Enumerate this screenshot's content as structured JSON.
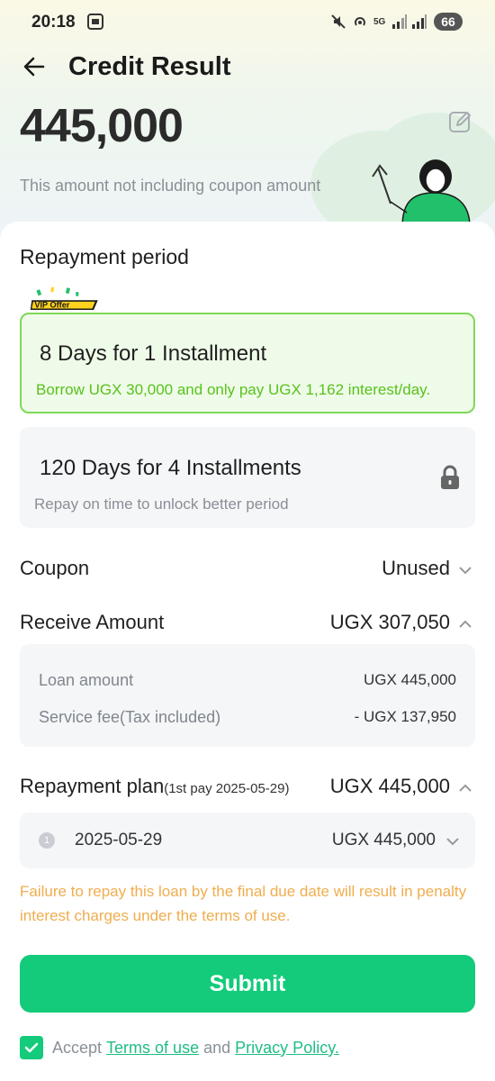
{
  "status_bar": {
    "time": "20:18",
    "battery": "66"
  },
  "header": {
    "title": "Credit Result"
  },
  "hero": {
    "amount": "445,000",
    "note": "This amount not including coupon amount"
  },
  "repayment_period": {
    "title": "Repayment period",
    "badge": "VIP Offer",
    "options": [
      {
        "title": "8 Days for 1 Installment",
        "subtitle": "Borrow UGX 30,000 and only pay UGX 1,162 interest/day."
      },
      {
        "title": "120 Days for 4 Installments",
        "subtitle": "Repay on time to unlock better period"
      }
    ]
  },
  "coupon": {
    "label": "Coupon",
    "value": "Unused"
  },
  "receive": {
    "label": "Receive Amount",
    "value": "UGX 307,050",
    "details": [
      {
        "label": "Loan amount",
        "value": "UGX 445,000"
      },
      {
        "label": "Service fee(Tax included)",
        "value": "- UGX 137,950"
      }
    ]
  },
  "plan": {
    "label": "Repayment plan",
    "first_pay": "(1st pay 2025-05-29)",
    "value": "UGX 445,000",
    "items": [
      {
        "index": "1",
        "date": "2025-05-29",
        "amount": "UGX 445,000"
      }
    ]
  },
  "warning": "Failure to repay this loan by the final due date will result in penalty interest charges under the terms of use.",
  "submit_label": "Submit",
  "consent": {
    "prefix": "Accept",
    "terms": "Terms of use",
    "and": "and",
    "privacy": "Privacy Policy."
  },
  "colors": {
    "primary": "#13cb7a",
    "vip_border": "#7ed957",
    "warning": "#f0ad4e"
  }
}
